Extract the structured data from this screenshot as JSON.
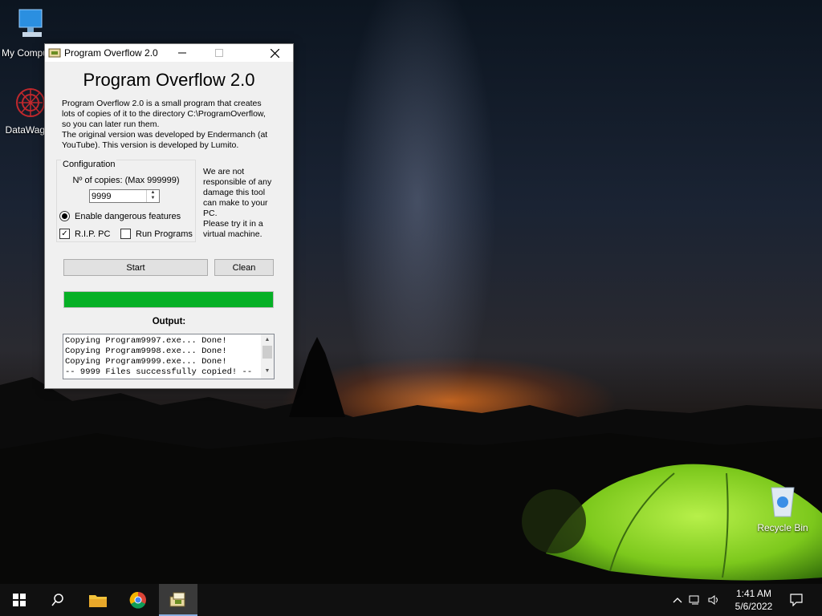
{
  "desktop": {
    "icons": [
      {
        "label": "My Computer",
        "icon": "computer-icon"
      },
      {
        "label": "DataWagon",
        "icon": "datawagon-icon"
      },
      {
        "label": "Recycle Bin",
        "icon": "recycle-bin-icon"
      }
    ]
  },
  "window": {
    "title": "Program Overflow 2.0",
    "heading": "Program Overflow 2.0",
    "description": [
      "Program Overflow 2.0 is a small program that creates",
      "lots of copies of it to the directory C:\\ProgramOverflow,",
      "so you can later run them.",
      "The original version was developed by Endermanch (at",
      "YouTube). This version is developed by Lumito."
    ],
    "configuration": {
      "legend": "Configuration",
      "copies_label": "Nº of copies: (Max 999999)",
      "copies_value": "9999",
      "dangerous_label": "Enable dangerous features",
      "dangerous_selected": true,
      "rip_label": "R.I.P. PC",
      "rip_checked": true,
      "run_label": "Run Programs",
      "run_checked": false
    },
    "disclaimer": [
      "We are not",
      "responsible of any",
      "damage this tool",
      "can make to your",
      "PC.",
      "Please try it in a",
      "virtual machine."
    ],
    "start_label": "Start",
    "clean_label": "Clean",
    "progress": 1.0,
    "progress_color": "#06b025",
    "output_label": "Output:",
    "output_lines": [
      "Copying Program9997.exe... Done!",
      "Copying Program9998.exe... Done!",
      "Copying Program9999.exe... Done!",
      "-- 9999 Files successfully copied! --"
    ]
  },
  "taskbar": {
    "items": [
      "start-icon",
      "search-icon",
      "file-explorer-icon",
      "chrome-icon",
      "program-overflow-icon"
    ],
    "time": "1:41 AM",
    "date": "5/6/2022"
  }
}
